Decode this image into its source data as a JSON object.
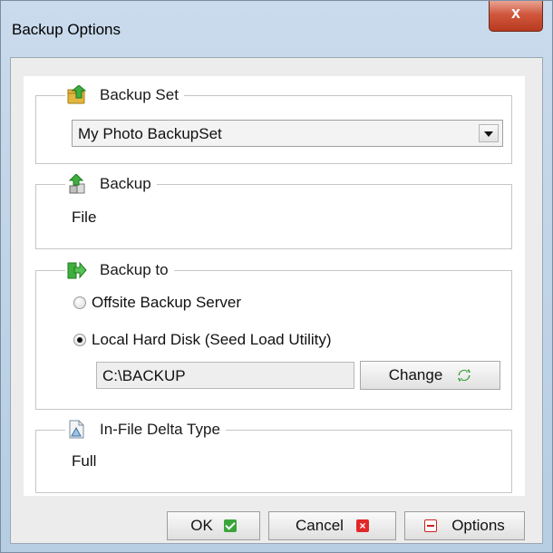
{
  "window": {
    "title": "Backup Options",
    "close_glyph": "x"
  },
  "backup_set": {
    "legend": "Backup Set",
    "icon": "folder-up-icon",
    "selected": "My Photo BackupSet"
  },
  "backup": {
    "legend": "Backup",
    "icon": "file-up-icon",
    "value": "File"
  },
  "backup_to": {
    "legend": "Backup to",
    "icon": "destination-arrow-icon",
    "options": [
      {
        "label": "Offsite Backup Server",
        "selected": false
      },
      {
        "label": "Local Hard Disk (Seed Load Utility)",
        "selected": true
      }
    ],
    "path": "C:\\BACKUP",
    "change_label": "Change"
  },
  "delta": {
    "legend": "In-File Delta Type",
    "icon": "delta-file-icon",
    "value": "Full"
  },
  "buttons": {
    "ok": "OK",
    "cancel": "Cancel",
    "options": "Options"
  },
  "colors": {
    "ok_icon": "#3aa53a",
    "cancel_icon": "#e02828",
    "close_button": "#c84a31"
  }
}
